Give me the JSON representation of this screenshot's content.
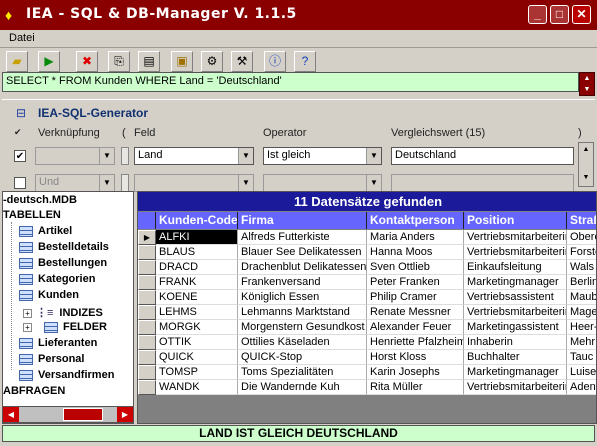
{
  "window": {
    "title": "IEA - SQL & DB-Manager V. 1.1.5"
  },
  "menu": {
    "file": "Datei"
  },
  "sql": {
    "query": "SELECT * FROM Kunden WHERE Land = 'Deutschland'"
  },
  "generator": {
    "title": "IEA-SQL-Generator",
    "labels": {
      "link": "Verknüpfung",
      "paren_open": "(",
      "field": "Feld",
      "operator": "Operator",
      "compare": "Vergleichswert (15)",
      "paren_close": ")"
    },
    "row1": {
      "checked": true,
      "field": "Land",
      "operator": "Ist gleich",
      "value": "Deutschland"
    },
    "row2": {
      "checked": false,
      "link": "Und"
    }
  },
  "tree": {
    "db": "-deutsch.MDB",
    "tables_header": "TABELLEN",
    "tables": [
      "Artikel",
      "Bestelldetails",
      "Bestellungen",
      "Kategorien",
      "Kunden"
    ],
    "kunden_children": [
      "INDIZES",
      "FELDER"
    ],
    "tables2": [
      "Lieferanten",
      "Personal",
      "Versandfirmen"
    ],
    "queries_header": "ABFRAGEN"
  },
  "grid": {
    "caption": "11 Datensätze gefunden",
    "columns": [
      "Kunden-Code",
      "Firma",
      "Kontaktperson",
      "Position",
      "Straß"
    ],
    "rows": [
      [
        "ALFKI",
        "Alfreds Futterkiste",
        "Maria Anders",
        "Vertriebsmitarbeiterin",
        "Obere"
      ],
      [
        "BLAUS",
        "Blauer See Delikatessen",
        "Hanna Moos",
        "Vertriebsmitarbeiterin",
        "Forste"
      ],
      [
        "DRACD",
        "Drachenblut Delikatessen",
        "Sven Ottlieb",
        "Einkaufsleitung",
        "Wals"
      ],
      [
        "FRANK",
        "Frankenversand",
        "Peter Franken",
        "Marketingmanager",
        "Berlin"
      ],
      [
        "KOENE",
        "Königlich Essen",
        "Philip Cramer",
        "Vertriebsassistent",
        "Maub"
      ],
      [
        "LEHMS",
        "Lehmanns Marktstand",
        "Renate Messner",
        "Vertriebsmitarbeiterin",
        "Mage"
      ],
      [
        "MORGK",
        "Morgenstern Gesundkost",
        "Alexander Feuer",
        "Marketingassistent",
        "Heer-"
      ],
      [
        "OTTIK",
        "Ottilies Käseladen",
        "Henriette Pfalzheim",
        "Inhaberin",
        "Mehr"
      ],
      [
        "QUICK",
        "QUICK-Stop",
        "Horst Kloss",
        "Buchhalter",
        "Tauc"
      ],
      [
        "TOMSP",
        "Toms Spezialitäten",
        "Karin Josephs",
        "Marketingmanager",
        "Luise"
      ],
      [
        "WANDK",
        "Die Wandernde Kuh",
        "Rita Müller",
        "Vertriebsmitarbeiterin",
        "Aden"
      ]
    ]
  },
  "status": {
    "text": "LAND IST GLEICH DEUTSCHLAND"
  },
  "colors": {
    "title_bg": "#8a0000",
    "grid_header": "#6666ff",
    "caption": "#1a1a9a",
    "sql_bg": "#ccffcc"
  },
  "icons": {
    "toolbar": [
      "open-folder-icon",
      "run-icon",
      "stop-icon",
      "copy-icon",
      "paste-icon",
      "image-icon",
      "settings-icon",
      "tools-icon",
      "info-icon",
      "help-icon"
    ]
  }
}
